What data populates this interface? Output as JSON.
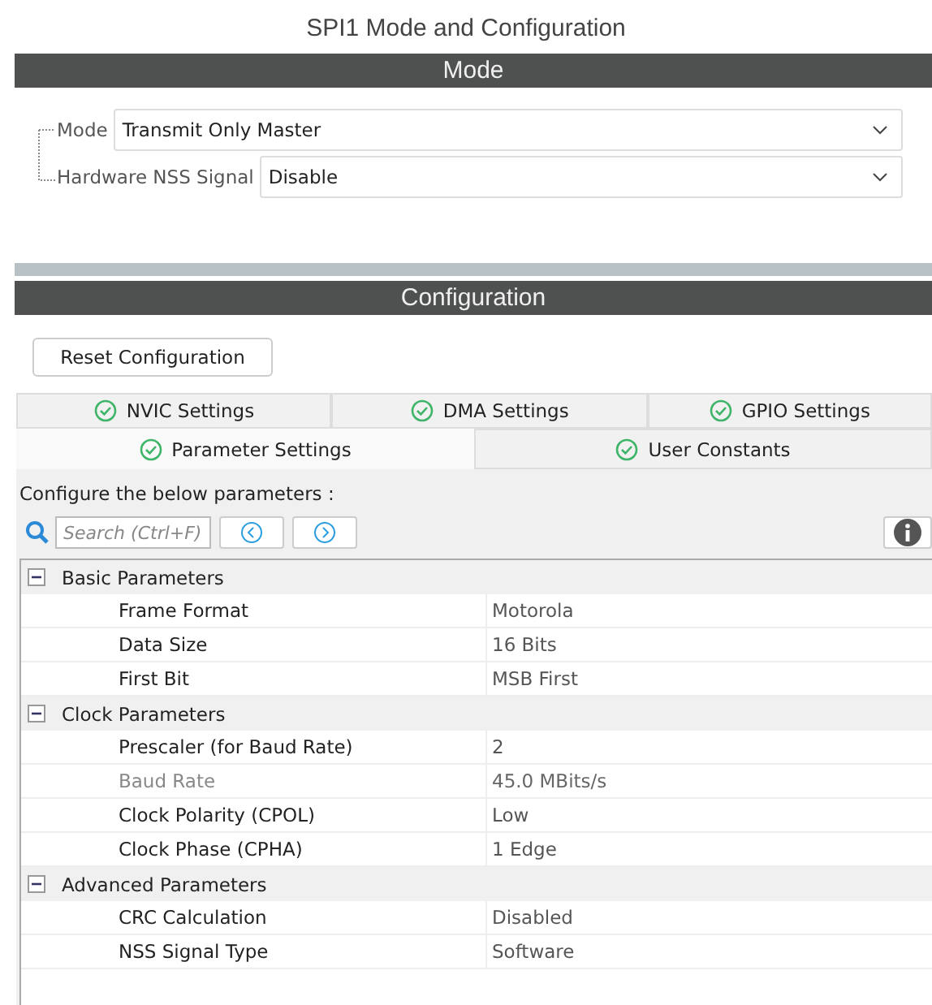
{
  "title": "SPI1 Mode and Configuration",
  "mode_section": {
    "header": "Mode",
    "fields": [
      {
        "label": "Mode",
        "value": "Transmit Only Master"
      },
      {
        "label": "Hardware NSS Signal",
        "value": "Disable"
      }
    ]
  },
  "config_section": {
    "header": "Configuration",
    "reset_button": "Reset Configuration",
    "tab_rows": [
      [
        {
          "label": "NVIC Settings",
          "selected": false
        },
        {
          "label": "DMA Settings",
          "selected": false
        },
        {
          "label": "GPIO Settings",
          "selected": false
        }
      ],
      [
        {
          "label": "Parameter Settings",
          "selected": true
        },
        {
          "label": "User Constants",
          "selected": false
        }
      ]
    ],
    "instructions": "Configure the below parameters :",
    "search": {
      "placeholder": "Search (Ctrl+F)"
    },
    "groups": [
      {
        "name": "Basic Parameters",
        "expanded": true,
        "rows": [
          {
            "name": "Frame Format",
            "value": "Motorola",
            "disabled": false
          },
          {
            "name": "Data Size",
            "value": "16 Bits",
            "disabled": false
          },
          {
            "name": "First Bit",
            "value": "MSB First",
            "disabled": false
          }
        ]
      },
      {
        "name": "Clock Parameters",
        "expanded": true,
        "rows": [
          {
            "name": "Prescaler (for Baud Rate)",
            "value": "2",
            "disabled": false
          },
          {
            "name": "Baud Rate",
            "value": "45.0 MBits/s",
            "disabled": true
          },
          {
            "name": "Clock Polarity (CPOL)",
            "value": "Low",
            "disabled": false
          },
          {
            "name": "Clock Phase (CPHA)",
            "value": "1 Edge",
            "disabled": false
          }
        ]
      },
      {
        "name": "Advanced Parameters",
        "expanded": true,
        "rows": [
          {
            "name": "CRC Calculation",
            "value": "Disabled",
            "disabled": false
          },
          {
            "name": "NSS Signal Type",
            "value": "Software",
            "disabled": false
          }
        ]
      }
    ]
  }
}
